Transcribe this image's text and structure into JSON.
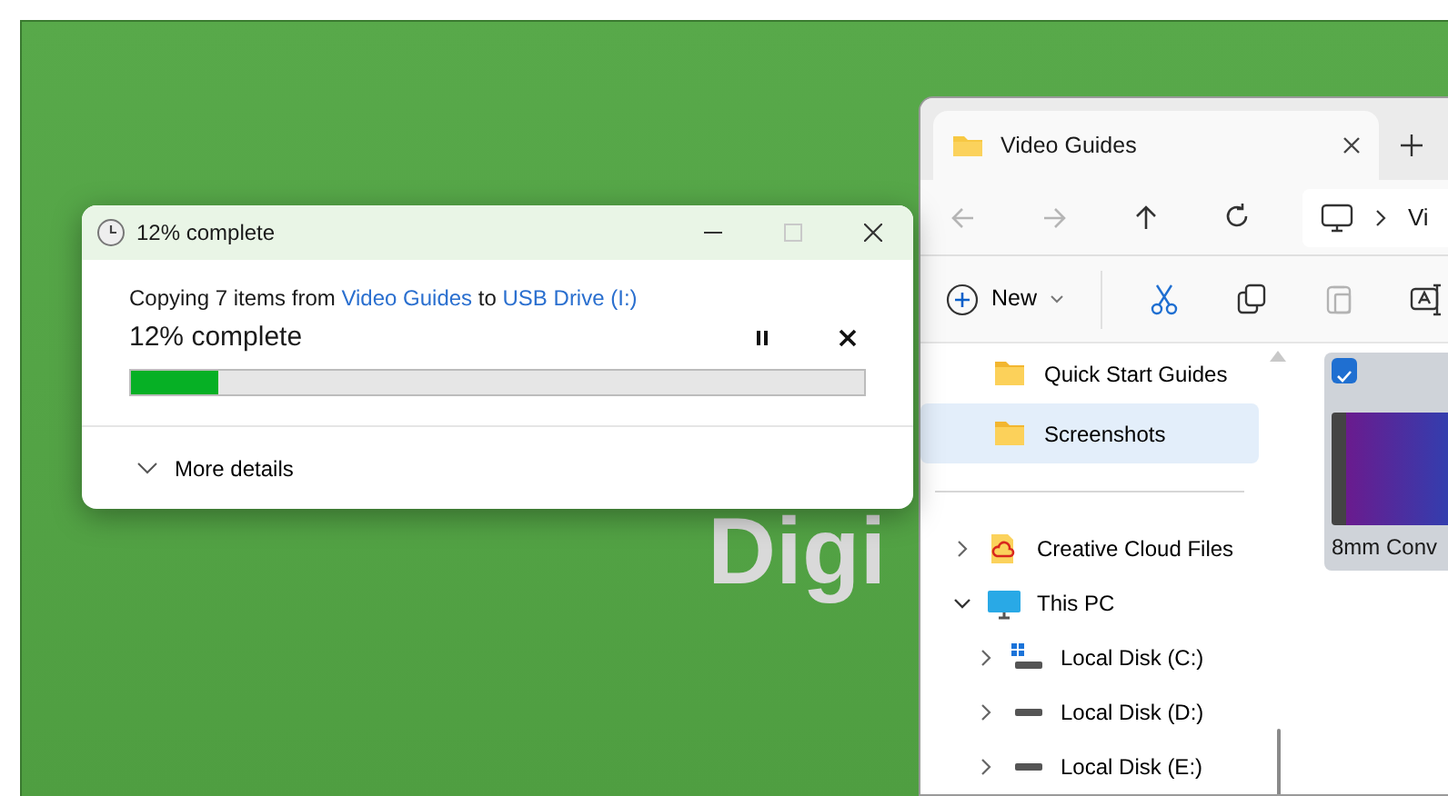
{
  "desktop": {
    "wallpaper_text": "Digi"
  },
  "copy_dialog": {
    "title": "12% complete",
    "title_buttons": [
      {
        "kind": "minimize",
        "disabled": false
      },
      {
        "kind": "maximize",
        "disabled": true
      },
      {
        "kind": "close",
        "disabled": false
      }
    ],
    "status_parts": [
      {
        "kind": "text",
        "text": "Copying 7 items from"
      },
      {
        "kind": "link",
        "text": "Video Guides"
      },
      {
        "kind": "text",
        "text": "to"
      },
      {
        "kind": "link",
        "text": "USB Drive (I:)"
      }
    ],
    "progress_text": "12% complete",
    "progress": {
      "level": 0.12
    },
    "actions": [
      {
        "kind": "pause"
      },
      {
        "kind": "stop"
      }
    ],
    "details": {
      "label": "More details",
      "expanded": false
    }
  },
  "explorer": {
    "tabs": [
      {
        "label": "Video Guides",
        "selected": true
      }
    ],
    "nav_buttons": [
      {
        "kind": "back",
        "disabled": true
      },
      {
        "kind": "forward",
        "disabled": true
      },
      {
        "kind": "up",
        "disabled": false
      },
      {
        "kind": "refresh",
        "disabled": false
      }
    ],
    "address": {
      "crumb": "Vi"
    },
    "toolbar": [
      {
        "kind": "new",
        "label": "New",
        "disabled": false
      },
      {
        "kind": "cut",
        "disabled": false
      },
      {
        "kind": "copy",
        "disabled": false
      },
      {
        "kind": "paste",
        "disabled": true
      },
      {
        "kind": "rename",
        "disabled": false
      }
    ],
    "nav_pane": {
      "top_items": [
        {
          "label": "Quick Start Guides",
          "kind": "folder",
          "selected": false
        },
        {
          "label": "Screenshots",
          "kind": "folder",
          "selected": true
        }
      ],
      "tree": [
        {
          "label": "Creative Cloud Files",
          "kind": "cloud",
          "expanded": false,
          "selected": false
        },
        {
          "label": "This PC",
          "kind": "pc",
          "expanded": true,
          "selected": false,
          "children": [
            {
              "label": "Local Disk (C:)",
              "kind": "system-disk",
              "expanded": false,
              "selected": false
            },
            {
              "label": "Local Disk (D:)",
              "kind": "disk",
              "expanded": false,
              "selected": false
            },
            {
              "label": "Local Disk (E:)",
              "kind": "disk",
              "expanded": false,
              "selected": false
            }
          ]
        }
      ]
    },
    "files": [
      {
        "name": "8mm Conv",
        "selected": true
      }
    ]
  }
}
